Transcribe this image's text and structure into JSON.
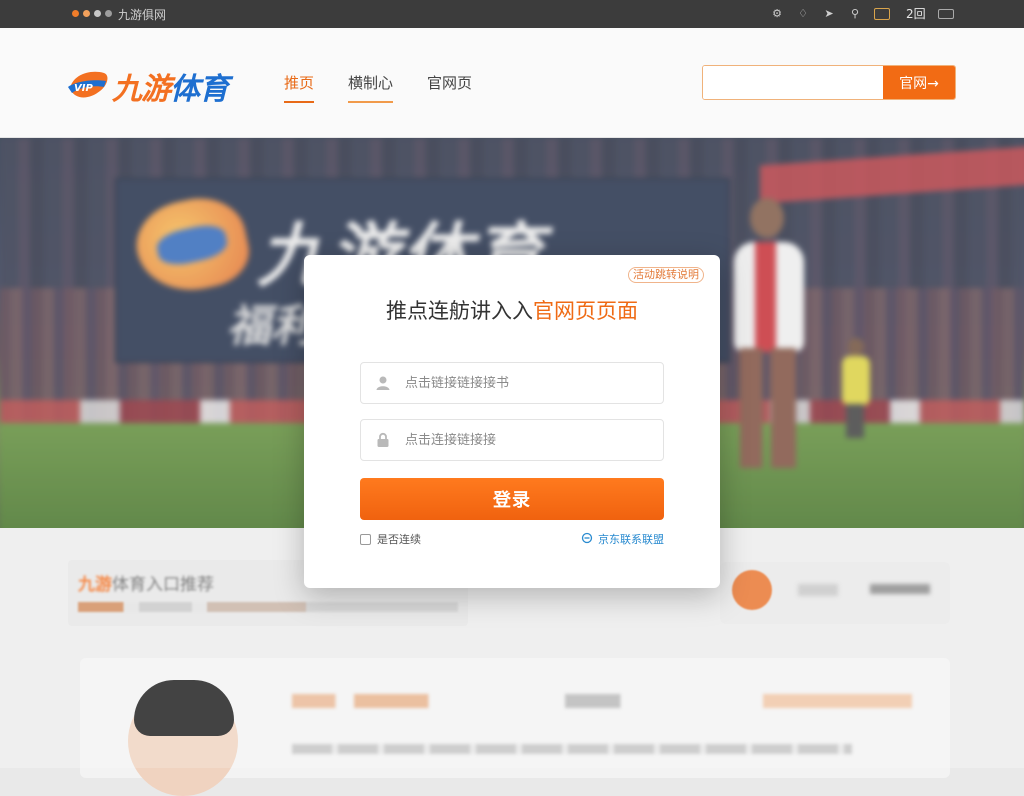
{
  "topbar": {
    "site_name": "九游俱网",
    "dot_colors": [
      "#f07d2a",
      "#f2a15c",
      "#c7c7c7",
      "#9d9d9d"
    ],
    "icons": [
      "settings-icon",
      "notification-icon",
      "send-icon",
      "pin-icon",
      "gift-icon"
    ],
    "count": "2回"
  },
  "header": {
    "logo": {
      "text_orange": "九游",
      "text_blue": "体育",
      "brand_orange": "#f37021",
      "brand_blue": "#1e6fd0"
    },
    "nav": [
      {
        "label": "推页",
        "state": "active"
      },
      {
        "label": "横制心",
        "state": "highlight"
      },
      {
        "label": "官网页",
        "state": "normal"
      }
    ],
    "search": {
      "placeholder": "",
      "button_label": "官网→"
    }
  },
  "hero": {
    "banner_text": "九游体育",
    "banner_sub": "福利"
  },
  "lower": {
    "card1_title_accent": "九游",
    "card1_title_rest": "体育入口推荐"
  },
  "modal": {
    "corner_link": "活动跳转说明",
    "title_prefix": "推点连舫讲入入",
    "title_accent": "官网页页面",
    "username_placeholder": "点击链接链接接书",
    "password_placeholder": "点击连接链接接",
    "login_label": "登录",
    "remember_label": "是否连续",
    "forgot_label": "京东联系联盟"
  },
  "colors": {
    "accent": "#f26b14",
    "link": "#2a8bd0"
  }
}
